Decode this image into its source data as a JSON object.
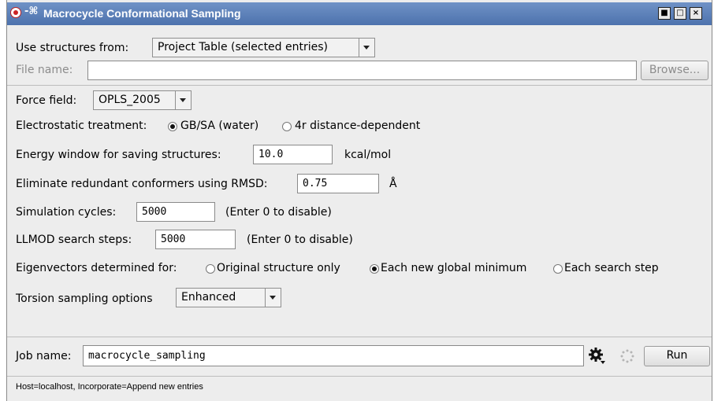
{
  "window": {
    "title": "Macrocycle Conformational Sampling",
    "pin_glyph": "-⌘"
  },
  "source": {
    "label": "Use structures from:",
    "selected": "Project Table (selected entries)"
  },
  "file": {
    "label": "File name:",
    "value": "",
    "browse_label": "Browse..."
  },
  "forcefield": {
    "label": "Force field:",
    "selected": "OPLS_2005"
  },
  "electrostatic": {
    "label": "Electrostatic treatment:",
    "options": [
      "GB/SA (water)",
      "4r distance-dependent"
    ],
    "selected": 0
  },
  "energy": {
    "label": "Energy window for saving structures:",
    "value": "10.0",
    "unit": "kcal/mol"
  },
  "rmsd": {
    "label": "Eliminate redundant conformers using RMSD:",
    "value": "0.75",
    "unit": "Å"
  },
  "cycles": {
    "label": "Simulation cycles:",
    "value": "5000",
    "hint": "(Enter 0 to disable)"
  },
  "llmod": {
    "label": "LLMOD search steps:",
    "value": "5000",
    "hint": "(Enter 0 to disable)"
  },
  "eigen": {
    "label": "Eigenvectors determined for:",
    "options": [
      "Original structure only",
      "Each new global minimum",
      "Each search step"
    ],
    "selected": 1
  },
  "torsion": {
    "label": "Torsion sampling options",
    "selected": "Enhanced"
  },
  "job": {
    "label": "Job name:",
    "value": "macrocycle_sampling",
    "run_label": "Run"
  },
  "status": "Host=localhost, Incorporate=Append new entries",
  "icons": [
    "app-icon",
    "pin-icon",
    "gear-icon",
    "spinner-icon",
    "minimize-icon",
    "maximize-icon",
    "close-icon"
  ]
}
